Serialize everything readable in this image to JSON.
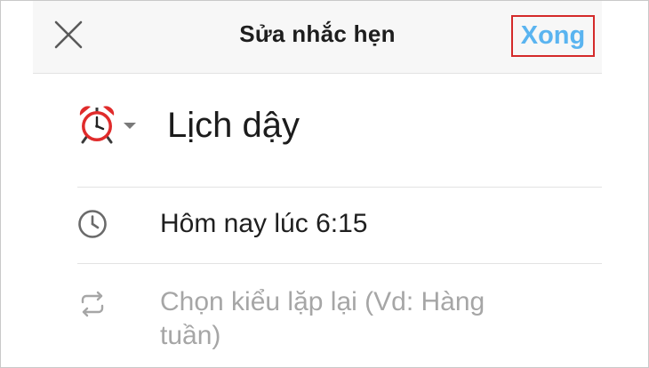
{
  "header": {
    "title": "Sửa nhắc hẹn",
    "done_label": "Xong",
    "close_icon": "close-icon"
  },
  "reminder": {
    "icon": "alarm-clock-icon",
    "title_value": "Lịch dậy"
  },
  "time": {
    "icon": "clock-icon",
    "value": "Hôm nay lúc 6:15"
  },
  "repeat": {
    "icon": "repeat-icon",
    "placeholder": "Chọn kiểu lặp lại (Vd: Hàng tuần)"
  },
  "colors": {
    "done_text": "#5ab4f0",
    "highlight_border": "#d42a2a",
    "header_bg": "#f7f7f7",
    "placeholder_text": "#a6a6a6"
  }
}
